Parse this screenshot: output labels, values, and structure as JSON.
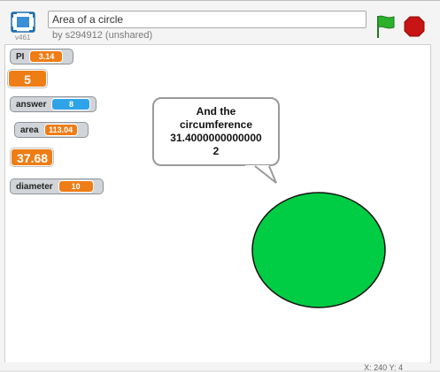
{
  "project": {
    "title": "Area of a circle",
    "byline": "by s294912 (unshared)",
    "version": "v461"
  },
  "controls": {
    "green_flag": "green-flag-icon",
    "stop": "stop-sign-icon",
    "fullscreen": "fullscreen-icon",
    "flag_color": "#2bb12b",
    "stop_color": "#c81414"
  },
  "monitors": {
    "pi": {
      "label": "PI",
      "value": "3.14"
    },
    "radius_large": {
      "value": "5"
    },
    "answer": {
      "label": "answer",
      "value": "8"
    },
    "area": {
      "label": "area",
      "value": "113.04"
    },
    "large_value": {
      "value": "37.68"
    },
    "diameter": {
      "label": "diameter",
      "value": "10"
    }
  },
  "speech_bubble": {
    "text": "And the\ncircumference\n31.4000000000000\n2"
  },
  "sprite": {
    "name": "green-circle",
    "fill": "#00cc44"
  },
  "status": {
    "mouse_xy": "X: 240  Y: 4"
  }
}
